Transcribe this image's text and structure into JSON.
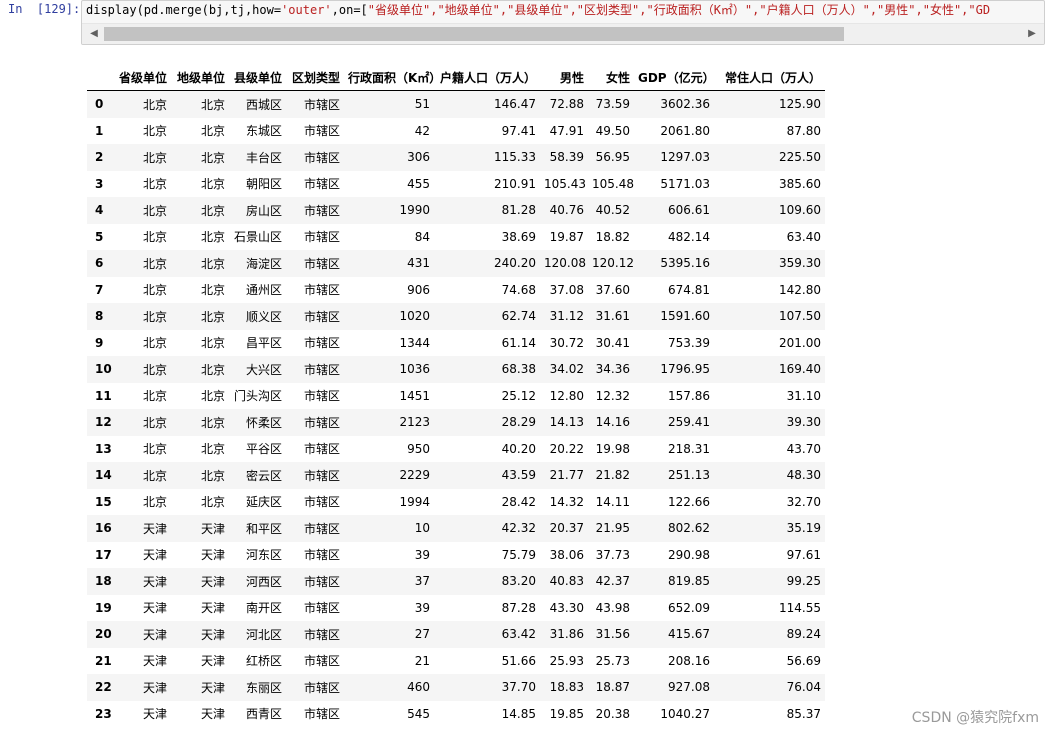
{
  "cell": {
    "prompt": "In  [129]:",
    "code_prefix": "display(pd.merge(bj,tj,how=",
    "code_str1": "'outer'",
    "code_mid": ",on=[",
    "code_str2": "\"省级单位\",\"地级单位\",\"县级单位\",\"区划类型\",\"行政面积（K㎡）\",\"户籍人口（万人）\",\"男性\",\"女性\",\"GD",
    "scroll_left_icon": "triangle-left-icon",
    "scroll_right_icon": "triangle-right-icon"
  },
  "table": {
    "columns": [
      "",
      "省级单位",
      "地级单位",
      "县级单位",
      "区划类型",
      "行政面积（K㎡）",
      "户籍人口（万人）",
      "男性",
      "女性",
      "GDP（亿元）",
      "常住人口（万人）"
    ],
    "rows": [
      [
        "0",
        "北京",
        "北京",
        "西城区",
        "市辖区",
        "51",
        "146.47",
        "72.88",
        "73.59",
        "3602.36",
        "125.90"
      ],
      [
        "1",
        "北京",
        "北京",
        "东城区",
        "市辖区",
        "42",
        "97.41",
        "47.91",
        "49.50",
        "2061.80",
        "87.80"
      ],
      [
        "2",
        "北京",
        "北京",
        "丰台区",
        "市辖区",
        "306",
        "115.33",
        "58.39",
        "56.95",
        "1297.03",
        "225.50"
      ],
      [
        "3",
        "北京",
        "北京",
        "朝阳区",
        "市辖区",
        "455",
        "210.91",
        "105.43",
        "105.48",
        "5171.03",
        "385.60"
      ],
      [
        "4",
        "北京",
        "北京",
        "房山区",
        "市辖区",
        "1990",
        "81.28",
        "40.76",
        "40.52",
        "606.61",
        "109.60"
      ],
      [
        "5",
        "北京",
        "北京",
        "石景山区",
        "市辖区",
        "84",
        "38.69",
        "19.87",
        "18.82",
        "482.14",
        "63.40"
      ],
      [
        "6",
        "北京",
        "北京",
        "海淀区",
        "市辖区",
        "431",
        "240.20",
        "120.08",
        "120.12",
        "5395.16",
        "359.30"
      ],
      [
        "7",
        "北京",
        "北京",
        "通州区",
        "市辖区",
        "906",
        "74.68",
        "37.08",
        "37.60",
        "674.81",
        "142.80"
      ],
      [
        "8",
        "北京",
        "北京",
        "顺义区",
        "市辖区",
        "1020",
        "62.74",
        "31.12",
        "31.61",
        "1591.60",
        "107.50"
      ],
      [
        "9",
        "北京",
        "北京",
        "昌平区",
        "市辖区",
        "1344",
        "61.14",
        "30.72",
        "30.41",
        "753.39",
        "201.00"
      ],
      [
        "10",
        "北京",
        "北京",
        "大兴区",
        "市辖区",
        "1036",
        "68.38",
        "34.02",
        "34.36",
        "1796.95",
        "169.40"
      ],
      [
        "11",
        "北京",
        "北京",
        "门头沟区",
        "市辖区",
        "1451",
        "25.12",
        "12.80",
        "12.32",
        "157.86",
        "31.10"
      ],
      [
        "12",
        "北京",
        "北京",
        "怀柔区",
        "市辖区",
        "2123",
        "28.29",
        "14.13",
        "14.16",
        "259.41",
        "39.30"
      ],
      [
        "13",
        "北京",
        "北京",
        "平谷区",
        "市辖区",
        "950",
        "40.20",
        "20.22",
        "19.98",
        "218.31",
        "43.70"
      ],
      [
        "14",
        "北京",
        "北京",
        "密云区",
        "市辖区",
        "2229",
        "43.59",
        "21.77",
        "21.82",
        "251.13",
        "48.30"
      ],
      [
        "15",
        "北京",
        "北京",
        "延庆区",
        "市辖区",
        "1994",
        "28.42",
        "14.32",
        "14.11",
        "122.66",
        "32.70"
      ],
      [
        "16",
        "天津",
        "天津",
        "和平区",
        "市辖区",
        "10",
        "42.32",
        "20.37",
        "21.95",
        "802.62",
        "35.19"
      ],
      [
        "17",
        "天津",
        "天津",
        "河东区",
        "市辖区",
        "39",
        "75.79",
        "38.06",
        "37.73",
        "290.98",
        "97.61"
      ],
      [
        "18",
        "天津",
        "天津",
        "河西区",
        "市辖区",
        "37",
        "83.20",
        "40.83",
        "42.37",
        "819.85",
        "99.25"
      ],
      [
        "19",
        "天津",
        "天津",
        "南开区",
        "市辖区",
        "39",
        "87.28",
        "43.30",
        "43.98",
        "652.09",
        "114.55"
      ],
      [
        "20",
        "天津",
        "天津",
        "河北区",
        "市辖区",
        "27",
        "63.42",
        "31.86",
        "31.56",
        "415.67",
        "89.24"
      ],
      [
        "21",
        "天津",
        "天津",
        "红桥区",
        "市辖区",
        "21",
        "51.66",
        "25.93",
        "25.73",
        "208.16",
        "56.69"
      ],
      [
        "22",
        "天津",
        "天津",
        "东丽区",
        "市辖区",
        "460",
        "37.70",
        "18.83",
        "18.87",
        "927.08",
        "76.04"
      ],
      [
        "23",
        "天津",
        "天津",
        "西青区",
        "市辖区",
        "545",
        "14.85",
        "19.85",
        "20.38",
        "1040.27",
        "85.37"
      ]
    ]
  },
  "watermark": "CSDN @猿究院fxm"
}
